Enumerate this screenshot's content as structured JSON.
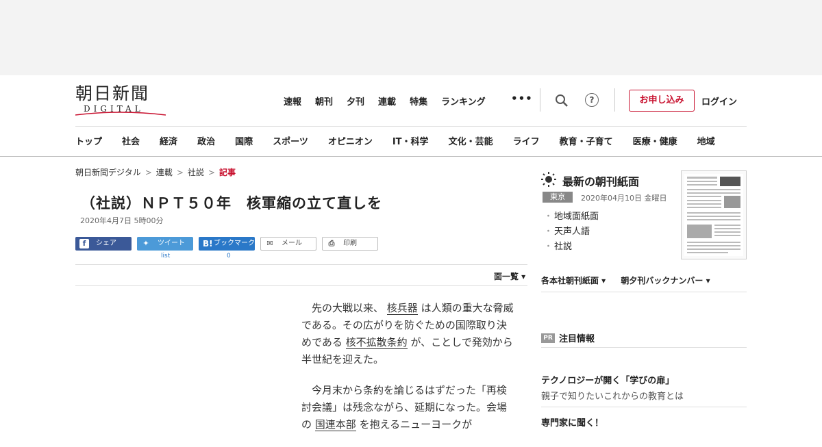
{
  "header": {
    "logo_text": "朝日新聞",
    "logo_sub": "DIGITAL",
    "top_nav": [
      "速報",
      "朝刊",
      "夕刊",
      "連載",
      "特集",
      "ランキング"
    ],
    "more": "•••",
    "help": "?",
    "signup": "お申し込み",
    "login": "ログイン",
    "categories": [
      "トップ",
      "社会",
      "経済",
      "政治",
      "国際",
      "スポーツ",
      "オピニオン",
      "IT・科学",
      "文化・芸能",
      "ライフ",
      "教育・子育て",
      "医療・健康",
      "地域"
    ]
  },
  "breadcrumb": {
    "items": [
      "朝日新聞デジタル",
      "連載",
      "社説"
    ],
    "current": "記事",
    "sep": ">"
  },
  "article": {
    "title": "（社説）ＮＰＴ５０年　核軍縮の立て直しを",
    "date": "2020年4月7日 5時00分",
    "share": {
      "facebook": "シェア",
      "twitter": "ツイート",
      "hatena": "ブックマーク",
      "mail": "メール",
      "print": "印刷",
      "twitter_count": "list",
      "hatena_count": "0"
    },
    "menu_list": "面一覧 ▾",
    "p1_a": "先の大戦以来、",
    "p1_link1": "核兵器",
    "p1_b": "は人類の重大な脅威である。その広がりを防ぐための国際取り決めである",
    "p1_link2": "核不拡散条約",
    "p1_c": "が、ことしで発効から半世紀を迎えた。",
    "p2_a": "今月末から条約を論じるはずだった「再検討会議」は残念ながら、延期になった。会場の",
    "p2_link": "国連本部",
    "p2_b": "を抱えるニューヨークが"
  },
  "sidebar": {
    "title": "最新の朝刊紙面",
    "region": "東京",
    "date": "2020年04月10日 金曜日",
    "links": [
      "地域面紙面",
      "天声人語",
      "社説"
    ],
    "drop1": "各本社朝刊紙面 ▾",
    "drop2": "朝夕刊バックナンバー ▾",
    "pr_tag": "PR",
    "pr_label": "注目情報",
    "promo1_title": "テクノロジーが開く「学びの扉」",
    "promo1_sub": "親子で知りたいこれからの教育とは",
    "promo2_title": "専門家に聞く！"
  },
  "colors": {
    "accent": "#c8102e",
    "facebook": "#3b5998",
    "twitter": "#4c9ad8",
    "hatena": "#2a78c8"
  }
}
